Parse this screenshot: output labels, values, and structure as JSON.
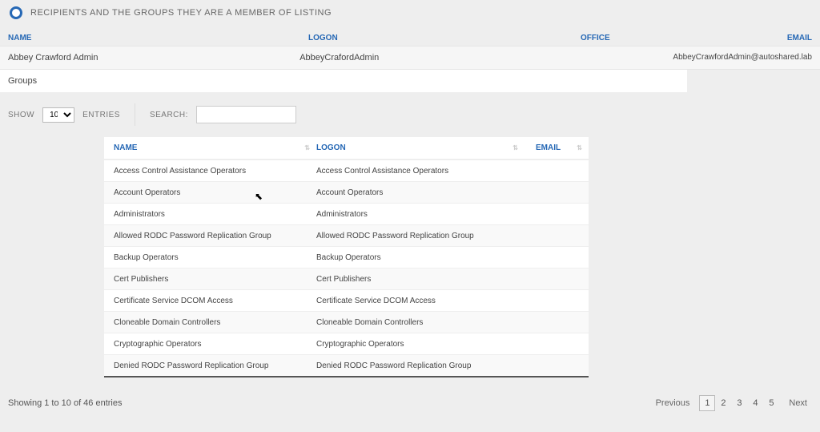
{
  "page_title": "RECIPIENTS AND THE GROUPS THEY ARE A MEMBER OF LISTING",
  "info_header": {
    "name": "NAME",
    "logon": "LOGON",
    "office": "OFFICE",
    "email": "EMAIL"
  },
  "info_row": {
    "name": "Abbey Crawford Admin",
    "logon": "AbbeyCrafordAdmin",
    "office": "",
    "email": "AbbeyCrawfordAdmin@autoshared.lab"
  },
  "groups_label": "Groups",
  "controls": {
    "show_label": "SHOW",
    "entries_label": "ENTRIES",
    "search_label": "SEARCH:",
    "show_value": "10",
    "search_value": ""
  },
  "table_header": {
    "name": "NAME",
    "logon": "LOGON",
    "email": "EMAIL"
  },
  "rows": [
    {
      "name": "Access Control Assistance Operators",
      "logon": "Access Control Assistance Operators",
      "email": ""
    },
    {
      "name": "Account Operators",
      "logon": "Account Operators",
      "email": ""
    },
    {
      "name": "Administrators",
      "logon": "Administrators",
      "email": ""
    },
    {
      "name": "Allowed RODC Password Replication Group",
      "logon": "Allowed RODC Password Replication Group",
      "email": ""
    },
    {
      "name": "Backup Operators",
      "logon": "Backup Operators",
      "email": ""
    },
    {
      "name": "Cert Publishers",
      "logon": "Cert Publishers",
      "email": ""
    },
    {
      "name": "Certificate Service DCOM Access",
      "logon": "Certificate Service DCOM Access",
      "email": ""
    },
    {
      "name": "Cloneable Domain Controllers",
      "logon": "Cloneable Domain Controllers",
      "email": ""
    },
    {
      "name": "Cryptographic Operators",
      "logon": "Cryptographic Operators",
      "email": ""
    },
    {
      "name": "Denied RODC Password Replication Group",
      "logon": "Denied RODC Password Replication Group",
      "email": ""
    }
  ],
  "footer": {
    "status": "Showing 1 to 10 of 46 entries",
    "prev": "Previous",
    "next": "Next",
    "pages": [
      "1",
      "2",
      "3",
      "4",
      "5"
    ],
    "current_page": 0
  }
}
